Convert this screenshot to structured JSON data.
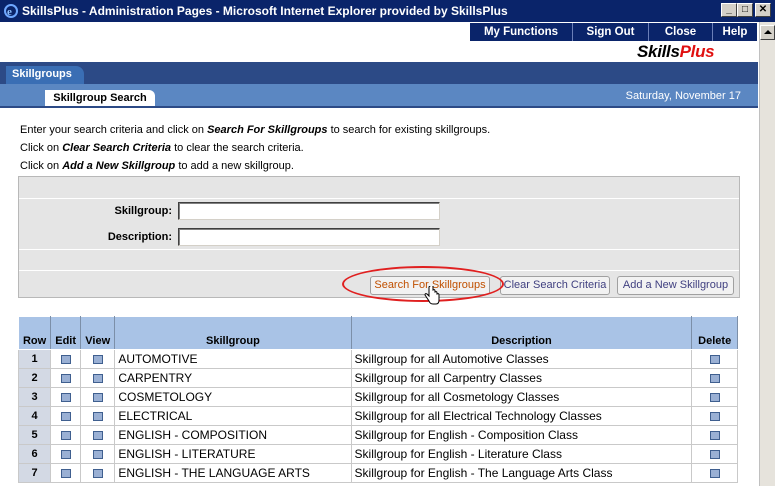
{
  "window": {
    "title": "SkillsPlus - Administration Pages - Microsoft Internet Explorer provided by SkillsPlus",
    "min": "_",
    "max": "□",
    "close": "✕"
  },
  "nav": {
    "my_functions": "My Functions",
    "sign_out": "Sign Out",
    "close": "Close",
    "help": "Help"
  },
  "logo": {
    "part1": "Skills",
    "part2": "Plus"
  },
  "tabs": {
    "main": "Skillgroups",
    "sub": "Skillgroup Search"
  },
  "date": "Saturday, November 17",
  "instructions": {
    "line1_pre": "Enter your search criteria and click on ",
    "line1_bold": "Search For Skillgroups",
    "line1_post": " to search for existing skillgroups.",
    "line2_pre": "Click on ",
    "line2_bold": "Clear Search Criteria",
    "line2_post": " to clear the search criteria.",
    "line3_pre": "Click on ",
    "line3_bold": "Add a New Skillgroup",
    "line3_post": " to add a new skillgroup."
  },
  "form": {
    "skillgroup_label": "Skillgroup:",
    "skillgroup_value": "",
    "description_label": "Description:",
    "description_value": ""
  },
  "buttons": {
    "search": "Search For Skillgroups",
    "clear": "Clear Search Criteria",
    "add": "Add a New Skillgroup"
  },
  "table": {
    "headers": [
      "Row",
      "Edit",
      "View",
      "Skillgroup",
      "Description",
      "Delete"
    ],
    "rows": [
      {
        "row": "1",
        "skillgroup": "AUTOMOTIVE",
        "description": "Skillgroup for all Automotive Classes"
      },
      {
        "row": "2",
        "skillgroup": "CARPENTRY",
        "description": "Skillgroup for all Carpentry Classes"
      },
      {
        "row": "3",
        "skillgroup": "COSMETOLOGY",
        "description": "Skillgroup for all Cosmetology Classes"
      },
      {
        "row": "4",
        "skillgroup": "ELECTRICAL",
        "description": "Skillgroup for all Electrical Technology Classes"
      },
      {
        "row": "5",
        "skillgroup": "ENGLISH - COMPOSITION",
        "description": "Skillgroup for English - Composition Class"
      },
      {
        "row": "6",
        "skillgroup": "ENGLISH - LITERATURE",
        "description": "Skillgroup for English - Literature Class"
      },
      {
        "row": "7",
        "skillgroup": "ENGLISH - THE LANGUAGE ARTS",
        "description": "Skillgroup for English - The Language Arts Class"
      }
    ]
  }
}
